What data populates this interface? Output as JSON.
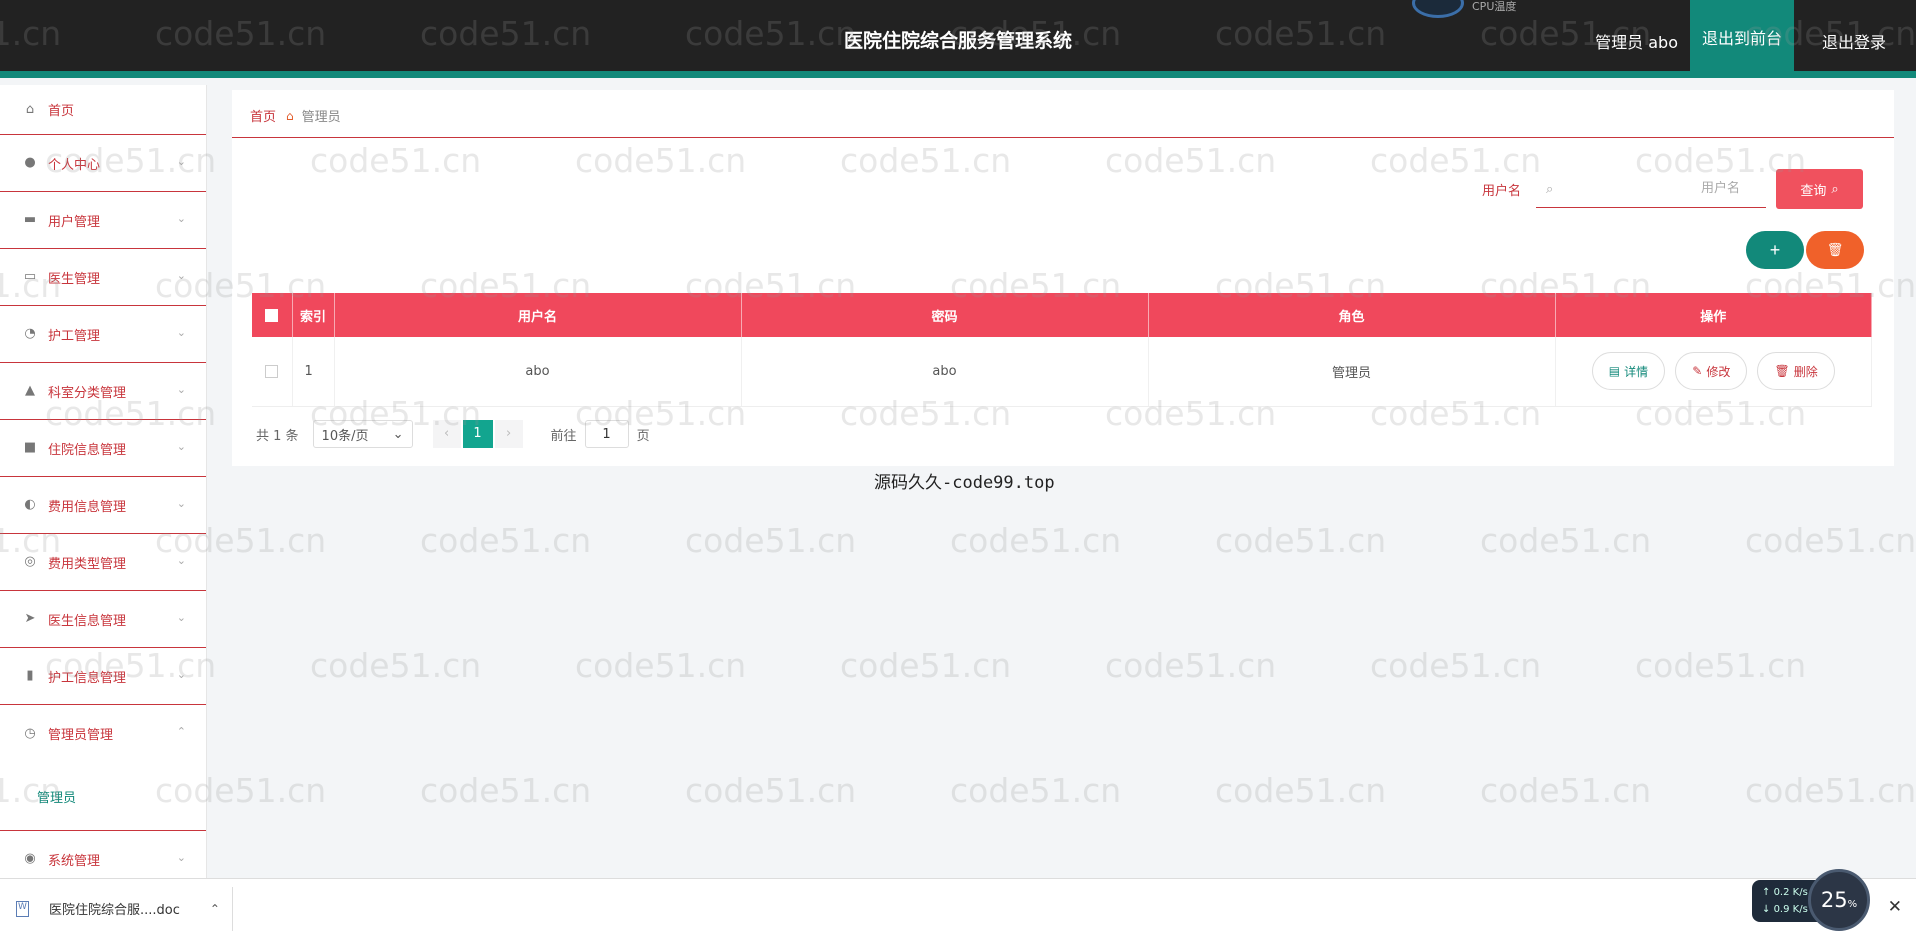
{
  "header": {
    "title": "医院住院综合服务管理系统",
    "user": "管理员 abo",
    "front_label": "退出到前台",
    "logout_label": "退出登录",
    "cpu_label": "CPU温度",
    "accent": "#12897a"
  },
  "sidebar": {
    "items": [
      {
        "label": "首页",
        "icon": "home-icon"
      },
      {
        "label": "个人中心",
        "icon": "user-icon"
      },
      {
        "label": "用户管理",
        "icon": "ticket-icon"
      },
      {
        "label": "医生管理",
        "icon": "monitor-icon"
      },
      {
        "label": "护工管理",
        "icon": "gauge-icon"
      },
      {
        "label": "科室分类管理",
        "icon": "person-icon"
      },
      {
        "label": "住院信息管理",
        "icon": "chat-icon"
      },
      {
        "label": "费用信息管理",
        "icon": "mic-icon"
      },
      {
        "label": "费用类型管理",
        "icon": "ball-icon"
      },
      {
        "label": "医生信息管理",
        "icon": "send-icon"
      },
      {
        "label": "护工信息管理",
        "icon": "bars-icon"
      },
      {
        "label": "管理员管理",
        "icon": "clock-icon"
      },
      {
        "label": "系统管理",
        "icon": "settings-icon"
      }
    ],
    "active_sub": "管理员"
  },
  "breadcrumb": {
    "home": "首页",
    "current": "管理员"
  },
  "search": {
    "label": "用户名",
    "placeholder": "用户名",
    "value": "",
    "button": "查询"
  },
  "toolbar": {
    "add": "+",
    "delete": "🗑"
  },
  "table": {
    "columns": [
      "索引",
      "用户名",
      "密码",
      "角色",
      "操作"
    ],
    "rows": [
      {
        "index": "1",
        "username": "abo",
        "password": "abo",
        "role": "管理员"
      }
    ],
    "actions": {
      "detail": "详情",
      "edit": "修改",
      "delete": "删除"
    }
  },
  "pagination": {
    "total": "共 1 条",
    "page_size": "10条/页",
    "current_page": "1",
    "goto_label": "前往",
    "goto_value": "1",
    "page_unit": "页"
  },
  "source_text": "源码久久-code99.top",
  "watermark": "code51.cn",
  "download_bar": {
    "file": "医院住院综合服....doc",
    "up_speed": "0.2",
    "down_speed": "0.9",
    "speed_unit": "K/s",
    "cpu_percent": "25",
    "percent_unit": "%"
  }
}
